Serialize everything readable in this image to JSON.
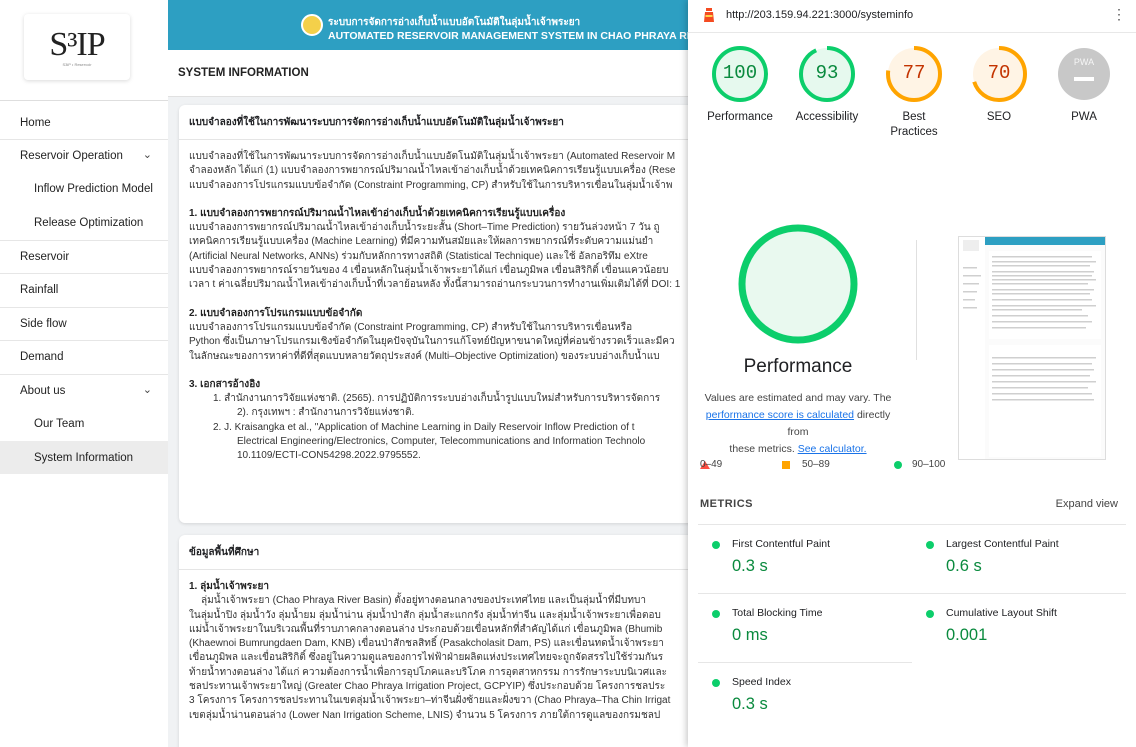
{
  "app": {
    "logo_text": "S³IP",
    "logo_sub": "S3iP • Reservoir",
    "banner_th": "ระบบการจัดการอ่างเก็บน้ำแบบอัตโนมัติในลุ่มน้ำเจ้าพระยา",
    "banner_en": "AUTOMATED RESERVOIR MANAGEMENT SYSTEM IN CHAO PHRAYA RIVER",
    "page_title": "SYSTEM INFORMATION"
  },
  "sidebar": {
    "items": [
      {
        "label": "Home"
      },
      {
        "label": "Reservoir Operation",
        "chevron": "⌄"
      },
      {
        "label": "Inflow Prediction Model"
      },
      {
        "label": "Release Optimization"
      },
      {
        "label": "Reservoir"
      },
      {
        "label": "Rainfall"
      },
      {
        "label": "Side flow"
      },
      {
        "label": "Demand"
      },
      {
        "label": "About us",
        "chevron": "⌄"
      },
      {
        "label": "Our Team"
      },
      {
        "label": "System Information"
      }
    ]
  },
  "card1": {
    "title": "แบบจำลองที่ใช้ในการพัฒนาระบบการจัดการอ่างเก็บน้ำแบบอัตโนมัติในลุ่มน้ำเจ้าพระยา",
    "intro": [
      "แบบจำลองที่ใช้ในการพัฒนาระบบการจัดการอ่างเก็บน้ำแบบอัตโนมัติในลุ่มน้ำเจ้าพระยา (Automated Reservoir M",
      "จำลองหลัก ได้แก่ (1) แบบจำลองการพยากรณ์ปริมาณน้ำไหลเข้าอ่างเก็บน้ำด้วยเทคนิคการเรียนรู้แบบเครื่อง (Rese",
      "แบบจำลองการโปรแกรมแบบข้อจำกัด (Constraint Programming, CP) สำหรับใช้ในการบริหารเขื่อนในลุ่มน้ำเจ้าพ"
    ],
    "s1_title": "1. แบบจำลองการพยากรณ์ปริมาณน้ำไหลเข้าอ่างเก็บน้ำด้วยเทคนิคการเรียนรู้แบบเครื่อง",
    "s1": [
      "แบบจำลองการพยากรณ์ปริมาณน้ำไหลเข้าอ่างเก็บน้ำระยะสั้น (Short–Time Prediction) รายวันล่วงหน้า 7 วัน ถู",
      "เทคนิคการเรียนรู้แบบเครื่อง (Machine Learning) ที่มีความทันสมัยและให้ผลการพยากรณ์ที่ระดับความแม่นยำ",
      "(Artificial Neural Networks, ANNs) ร่วมกับหลักการทางสถิติ (Statistical Technique) และใช้ อัลกอริทึม eXtre",
      "แบบจำลองการพยากรณ์รายวันของ 4 เขื่อนหลักในลุ่มน้ำเจ้าพระยาได้แก่ เขื่อนภูมิพล เขื่อนสิริกิติ์ เขื่อนแควน้อยบ",
      "เวลา t ค่าเฉลี่ยปริมาณน้ำไหลเข้าอ่างเก็บน้ำที่เวลาย้อนหลัง ทั้งนี้สามารถอ่านกระบวนการทำงานเพิ่มเติมได้ที่ DOI: 1"
    ],
    "s2_title": "2. แบบจำลองการโปรแกรมแบบข้อจำกัด",
    "s2": [
      "แบบจำลองการโปรแกรมแบบข้อจำกัด (Constraint Programming, CP) สำหรับใช้ในการบริหารเขื่อนหรือ",
      "Python ซึ่งเป็นภาษาโปรแกรมเชิงข้อจำกัดในยุคปัจจุบันในการแก้โจทย์ปัญหาขนาดใหญ่ที่ค่อนข้างรวดเร็วและมีคว",
      "ในลักษณะของการหาค่าที่ดีที่สุดแบบหลายวัตถุประสงค์ (Multi–Objective Optimization) ของระบบอ่างเก็บน้ำแบ"
    ],
    "s3_title": "3. เอกสารอ้างอิง",
    "refs": [
      "1. สำนักงานการวิจัยแห่งชาติ. (2565). การปฏิบัติการระบบอ่างเก็บน้ำรูปแบบใหม่สำหรับการบริหารจัดการ",
      "2). กรุงเทพฯ : สำนักงานการวิจัยแห่งชาติ.",
      "2. J. Kraisangka et al., \"Application of Machine Learning in Daily Reservoir Inflow Prediction of t",
      "Electrical Engineering/Electronics, Computer, Telecommunications and Information Technolo",
      "10.1109/ECTI-CON54298.2022.9795552."
    ]
  },
  "card2": {
    "title": "ข้อมูลพื้นที่ศึกษา",
    "s1_title": "1. ลุ่มน้ำเจ้าพระยา",
    "lines": [
      "ลุ่มน้ำเจ้าพระยา (Chao Phraya River Basin) ตั้งอยู่ทางตอนกลางของประเทศไทย และเป็นลุ่มน้ำที่มีบทบา",
      "ในลุ่มน้ำปิง ลุ่มน้ำวัง ลุ่มน้ำยม ลุ่มน้ำน่าน ลุ่มน้ำป่าสัก ลุ่มน้ำสะแกกรัง ลุ่มน้ำท่าจีน และลุ่มน้ำเจ้าพระยาเพื่อตอบ",
      "แม่น้ำเจ้าพระยาในบริเวณพื้นที่ราบภาคกลางตอนล่าง ประกอบด้วยเขื่อนหลักที่สำคัญได้แก่ เขื่อนภูมิพล (Bhumib",
      "(Khaewnoi Bumrungdaen Dam, KNB) เขื่อนป่าสักชลสิทธิ์ (Pasakcholasit Dam, PS) และเขื่อนทดน้ำเจ้าพระยา",
      "เขื่อนภูมิพล และเขื่อนสิริกิติ์ ซึ่งอยู่ในความดูแลของการไฟฟ้าฝ่ายผลิตแห่งประเทศไทยจะถูกจัดสรรไปใช้ร่วมกันร",
      "ท้ายน้ำทางตอนล่าง ได้แก่ ความต้องการน้ำเพื่อการอุปโภคและบริโภค การอุตสาหกรรม การรักษาระบบนิเวศและ",
      "ชลประทานเจ้าพระยาใหญ่ (Greater Chao Phraya Irrigation Project, GCPYIP) ซึ่งประกอบด้วย โครงการชลประ",
      "3 โครงการ โครงการชลประทานในเขตลุ่มน้ำเจ้าพระยา–ท่าจีนฝั่งซ้ายและฝั่งขวา (Chao Phraya–Tha Chin Irrigat",
      "เขตลุ่มน้ำน่านตอนล่าง (Lower Nan Irrigation Scheme, LNIS) จำนวน 5 โครงการ ภายใต้การดูแลของกรมชลป"
    ]
  },
  "lighthouse": {
    "url": "http://203.159.94.221:3000/systeminfo",
    "kebab": "⋮",
    "scores": [
      {
        "label": "Performance",
        "value": "100",
        "score": 100,
        "color": "#0cce6b",
        "text_color": "#0a8a3e",
        "bg": "#e6f9ee"
      },
      {
        "label": "Accessibility",
        "value": "93",
        "score": 93,
        "color": "#0cce6b",
        "text_color": "#0a8a3e",
        "bg": "#e6f9ee"
      },
      {
        "label": "Best Practices",
        "value": "77",
        "score": 77,
        "color": "#ffa400",
        "text_color": "#c33300",
        "bg": "#fff4e5"
      },
      {
        "label": "SEO",
        "value": "70",
        "score": 70,
        "color": "#ffa400",
        "text_color": "#c33300",
        "bg": "#fff4e5"
      },
      {
        "label": "PWA",
        "value": "PWA",
        "score": null,
        "color": "#c8c8c8",
        "text_color": "#ffffff",
        "bg": "#c8c8c8"
      }
    ],
    "big_label": "Performance",
    "note_line1": "Values are estimated and may vary. The",
    "note_link1": "performance score is calculated",
    "note_line2": " directly from",
    "note_line3": "these metrics.",
    "note_link2": "See calculator.",
    "legend": [
      "0–49",
      "50–89",
      "90–100"
    ],
    "metrics_title": "METRICS",
    "expand_label": "Expand view",
    "metrics": [
      {
        "name": "First Contentful Paint",
        "value": "0.3 s"
      },
      {
        "name": "Largest Contentful Paint",
        "value": "0.6 s"
      },
      {
        "name": "Total Blocking Time",
        "value": "0 ms"
      },
      {
        "name": "Cumulative Layout Shift",
        "value": "0.001"
      },
      {
        "name": "Speed Index",
        "value": "0.3 s"
      }
    ]
  }
}
